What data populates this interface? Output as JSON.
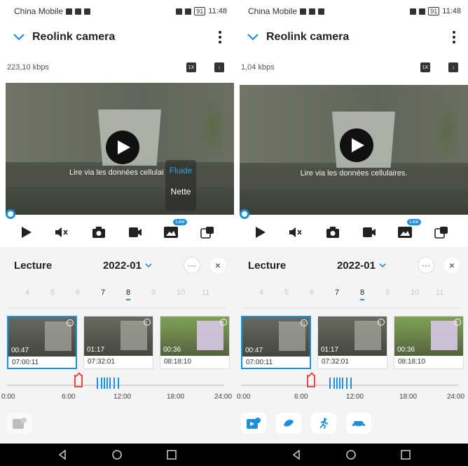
{
  "status_bar": {
    "carrier": "China Mobile",
    "battery": "91",
    "time": "11:48"
  },
  "header": {
    "title": "Reolink camera"
  },
  "left": {
    "bitrate": "223,10 kbps",
    "speed_badge": "1X",
    "video_message": "Lire via les données cellulai",
    "quality_menu": [
      "Fluide",
      "Nette"
    ],
    "quality_selected": "Fluide",
    "low_badge": "Low"
  },
  "right": {
    "bitrate": "1,04 kbps",
    "speed_badge": "1X",
    "video_message": "Lire via les données cellulaires.",
    "low_badge": "Low"
  },
  "playback": {
    "title": "Lecture",
    "month": "2022-01",
    "more_label": "···",
    "close_label": "×",
    "days": [
      "4",
      "5",
      "6",
      "7",
      "8",
      "9",
      "10",
      "11"
    ],
    "active_days": [
      "7",
      "8"
    ],
    "selected_day": "8",
    "clips": [
      {
        "duration": "00:47",
        "time": "07:00:11"
      },
      {
        "duration": "01:17",
        "time": "07:32:01"
      },
      {
        "duration": "00:36",
        "time": "08:18:10"
      }
    ],
    "timeline_ticks": [
      "0:00",
      "6:00",
      "12:00",
      "18:00",
      "24:00"
    ]
  },
  "colors": {
    "accent": "#1e8fd8",
    "marker": "#ee4444"
  }
}
